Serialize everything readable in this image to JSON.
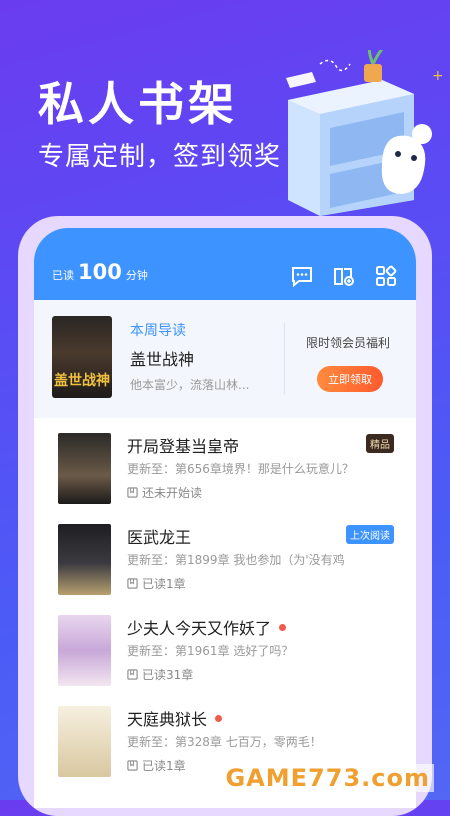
{
  "hero": {
    "title": "私人书架",
    "subtitle": "专属定制，签到领奖"
  },
  "header": {
    "read_prefix": "已读",
    "read_minutes": "100",
    "read_unit": "分钟",
    "icons": [
      "message-icon",
      "book-add-icon",
      "grid-menu-icon"
    ]
  },
  "featured": {
    "tag": "本周导读",
    "title": "盖世战神",
    "description": "他本富少，流落山林...",
    "cover_text": "盖世战神",
    "vip_text": "限时领会员福利",
    "vip_button": "立即领取"
  },
  "books": [
    {
      "title": "开局登基当皇帝",
      "update": "更新至：第656章境界！那是什么玩意儿？",
      "progress": "还未开始读",
      "badge": "精品",
      "badge_color": "#3a2a20",
      "dot": false
    },
    {
      "title": "医武龙王",
      "update": "更新至：第1899章 我也参加（为'没有鸡",
      "progress": "已读1章",
      "badge": "上次阅读",
      "badge_color": "#3d93ff",
      "dot": false
    },
    {
      "title": "少夫人今天又作妖了",
      "update": "更新至：第1961章 选好了吗？",
      "progress": "已读31章",
      "badge": "",
      "dot": true
    },
    {
      "title": "天庭典狱长",
      "update": "更新至：第328章 七百万，零两毛！",
      "progress": "已读1章",
      "badge": "",
      "dot": true
    }
  ],
  "watermark": "GAME773.com",
  "colors": {
    "accent": "#3d93ff",
    "background": "#5a4cf4",
    "button": "#ff6a34",
    "dot": "#f25a4a"
  }
}
